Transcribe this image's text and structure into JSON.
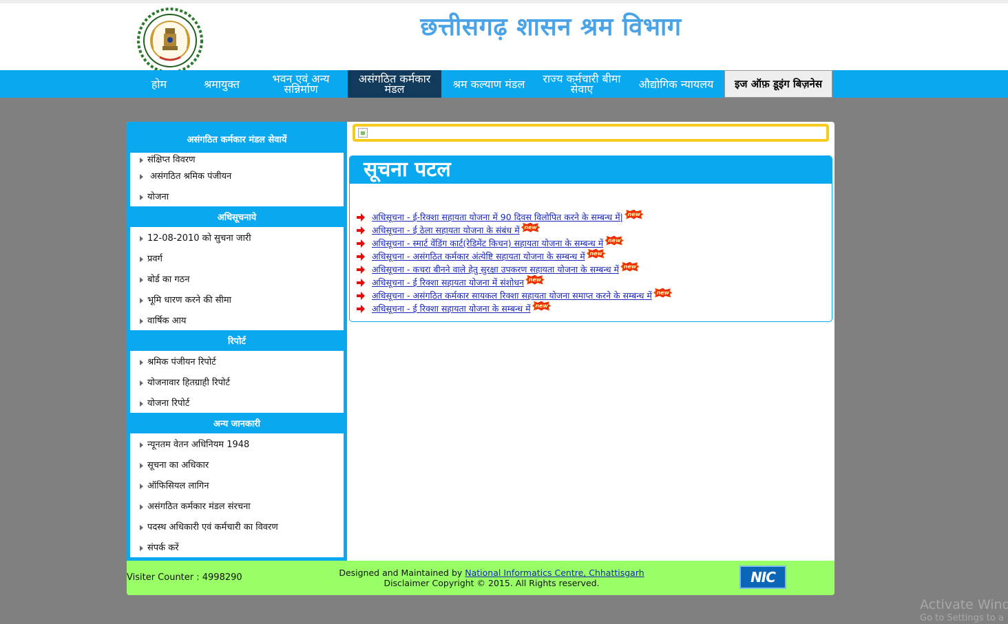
{
  "header": {
    "title": "छत्तीसगढ़ शासन श्रम विभाग",
    "emblem_text": "छत्तीसगढ़ शासन"
  },
  "nav": {
    "items": [
      {
        "label": "होम"
      },
      {
        "label": "श्रमायुक्त"
      },
      {
        "label": "भवन एवं अन्य सन्निर्माण"
      },
      {
        "label": "असंगठित कर्मकार मंडल"
      },
      {
        "label": "श्रम कल्याण मंडल"
      },
      {
        "label": "राज्य कर्मचारी बीमा सेवाए"
      },
      {
        "label": "औद्योगिक न्यायलय"
      },
      {
        "label": "इज ऑफ़ डूइंग बिज़नेस"
      }
    ]
  },
  "sidebar": {
    "sections": [
      {
        "heading": "असंगठित कर्मकार मंडल सेवायें",
        "items": [
          "संक्षिप्त विवरण",
          " असंगठित श्रमिक पंजीयन",
          "योजना"
        ]
      },
      {
        "heading": "अधिसूचनाये",
        "items": [
          "12-08-2010 को सुचना जारी",
          "प्रवर्ग",
          "बोर्ड का गठन",
          "भूमि धारण करने की सीमा",
          "वार्षिक आय"
        ]
      },
      {
        "heading": "रिपोर्ट",
        "items": [
          "श्रमिक पंजीयन रिपोर्ट",
          "योजनावार हितग्राही रिपोर्ट",
          "योजना रिपोर्ट"
        ]
      },
      {
        "heading": "अन्य जानकारी",
        "items": [
          "न्यूनतम वेतन अधिनियम 1948",
          "सूचना का अधिकार",
          "ऑफिसियल लागिन",
          "असंगठित कर्मकार मंडल संरचना",
          "पदस्थ अधिकारी एवं कर्मचारी का विवरण",
          "संपर्क करें"
        ]
      }
    ]
  },
  "notice": {
    "heading": "सूचना पटल",
    "badge": "new",
    "items": [
      "अधिसूचना - ई-रिक्शा सहायता योजना में 90 दिवस विलोपित करने के सम्बन्ध में|",
      "अधिसूचना - ई ठेला सहायता योजना के संबंध में",
      "अधिसूचना - स्मार्ट वेंडिंग कार्ट(रेडिमेंट किचन) सहायता योजना के सम्बन्ध में",
      "अधिसूचना - असंगठित कर्मकार अंत्येष्टि सहायता योजना के सम्बन्ध में",
      "अधिसूचना - कचरा बीनने वाले हेतु सुरक्षा उपकरण सहायता योजना के सम्बन्ध में",
      "अधिसूचना - ई रिक्शा सहायता योजना में संशोधन ",
      "अधिसूचना - असंगठित कर्मकार सायकल रिक्शा सहायता योजना समाप्त करने के सम्बन्ध में",
      "अधिसूचना - ई रिक्शा सहायता योजना के सम्बन्ध में"
    ]
  },
  "footer": {
    "visitor": "Visiter Counter : 4998290",
    "designed_prefix": "Designed and Maintained by ",
    "designed_link": "National Informatics Centre, Chhattisgarh",
    "disclaimer": "Disclaimer Copyright © 2015. All Rights reserved.",
    "logo_text": "NIC"
  },
  "watermark": {
    "line1": "Activate Windo",
    "line2": "Go to Settings to a"
  },
  "colors": {
    "nav_bg": "#0aa8ef",
    "nav_active": "#123a5c",
    "footer_bg": "#99ff66",
    "title": "#4aa3e6",
    "page_bg": "#808080"
  }
}
